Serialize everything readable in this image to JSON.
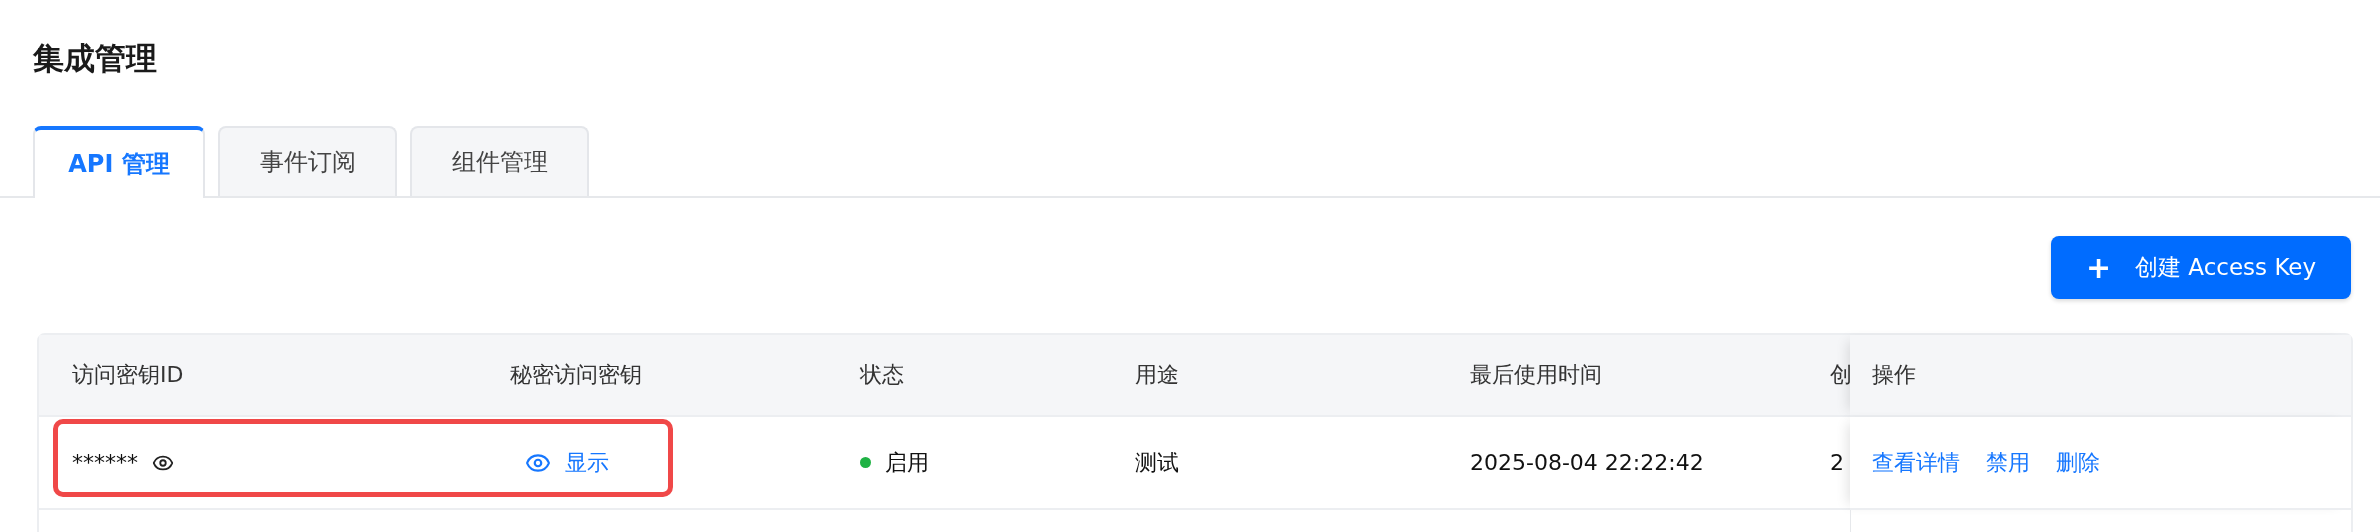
{
  "page_title": "集成管理",
  "tabs": [
    {
      "label": "API 管理",
      "selected": true
    },
    {
      "label": "事件订阅",
      "selected": false
    },
    {
      "label": "组件管理",
      "selected": false
    }
  ],
  "create_button": {
    "icon": "+",
    "label": "创建 Access Key"
  },
  "table": {
    "columns": [
      "访问密钥ID",
      "秘密访问密钥",
      "状态",
      "用途",
      "最后使用时间",
      "创"
    ],
    "action_column": "操作",
    "rows": [
      {
        "access_key_id": "******",
        "secret_action": "显示",
        "status": {
          "label": "启用",
          "color": "#1fb244"
        },
        "purpose": "测试",
        "last_used": "2025-08-04 22:22:42",
        "column_6": "2",
        "actions": [
          "查看详情",
          "禁用",
          "删除"
        ],
        "highlighted": true
      }
    ]
  }
}
